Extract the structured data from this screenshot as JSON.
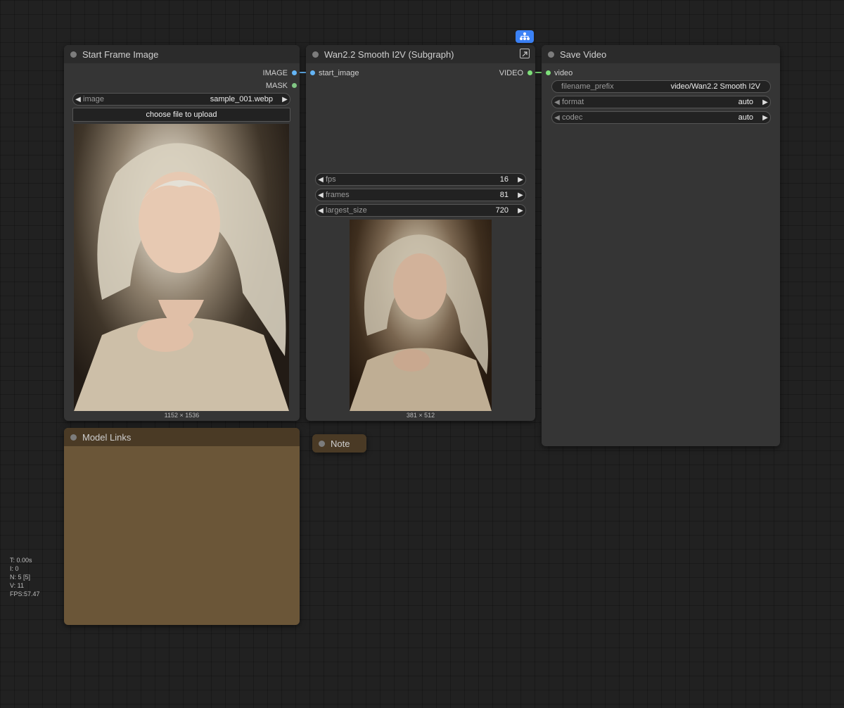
{
  "graph": {
    "subgraph_badge_icon": "subgraph-icon",
    "link_colors": {
      "image": "#64b5f6",
      "video": "#7ee07a"
    }
  },
  "nodes": {
    "start_frame": {
      "title": "Start Frame Image",
      "outputs": {
        "image": "IMAGE",
        "mask": "MASK"
      },
      "image_widget": {
        "label": "image",
        "value": "sample_001.webp"
      },
      "upload_button": "choose file to upload",
      "preview_dims": "1152 × 1536"
    },
    "wan": {
      "title": "Wan2.2 Smooth I2V (Subgraph)",
      "input": "start_image",
      "output": "VIDEO",
      "expand_icon": "open-subgraph-icon",
      "widgets": [
        {
          "label": "fps",
          "value": "16"
        },
        {
          "label": "frames",
          "value": "81"
        },
        {
          "label": "largest_size",
          "value": "720"
        }
      ],
      "preview_dims": "381 × 512"
    },
    "save_video": {
      "title": "Save Video",
      "input": "video",
      "widgets": [
        {
          "label": "filename_prefix",
          "value": "video/Wan2.2 Smooth I2V"
        },
        {
          "label": "format",
          "value": "auto"
        },
        {
          "label": "codec",
          "value": "auto"
        }
      ]
    },
    "model_links": {
      "title": "Model Links",
      "color": "#6b5638",
      "header_color": "#4a3a25"
    },
    "note": {
      "title": "Note",
      "color": "#4a3a25"
    }
  },
  "stats": {
    "t": "T: 0.00s",
    "i": "I: 0",
    "n": "N: 5 [5]",
    "v": "V: 11",
    "fps": "FPS:57.47"
  }
}
